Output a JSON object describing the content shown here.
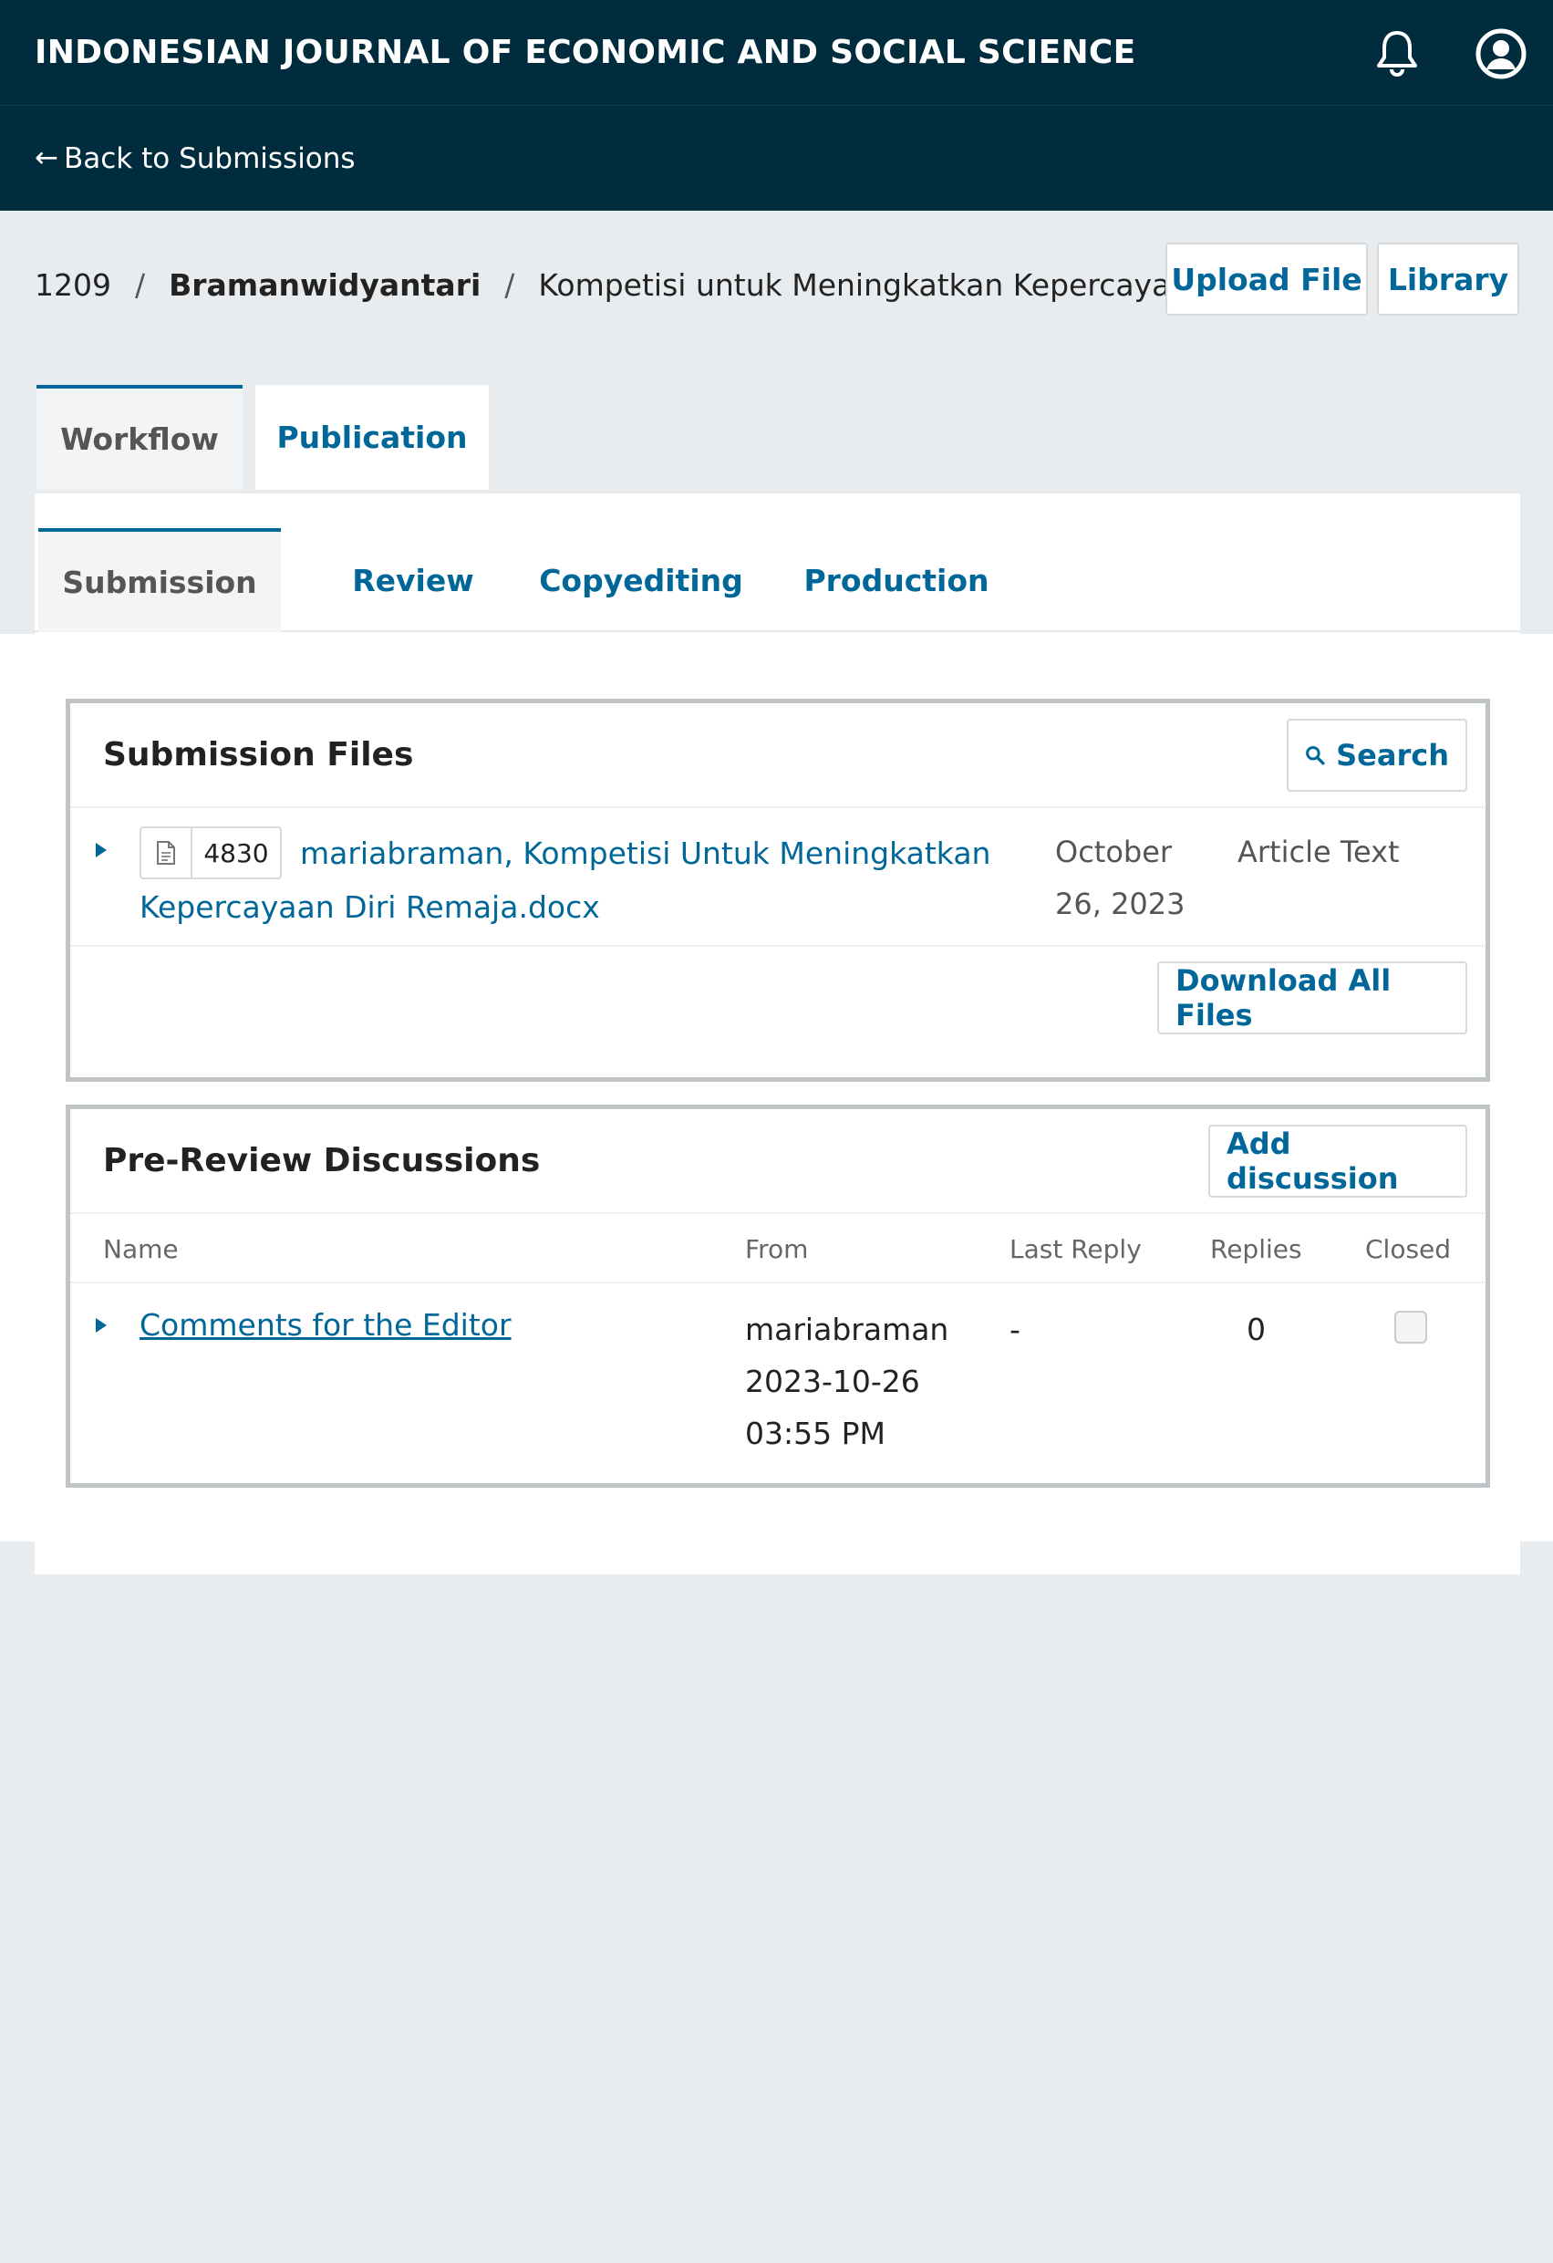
{
  "header": {
    "journal_title": "INDONESIAN JOURNAL OF ECONOMIC AND SOCIAL SCIENCE",
    "notification_icon": "bell-icon",
    "profile_icon": "user-circle-icon",
    "back_link": "Back to Submissions"
  },
  "breadcrumb": {
    "submission_id": "1209",
    "separator": "/",
    "author": "Bramanwidyantari",
    "title": "Kompetisi untuk Meningkatkan Kepercayaar"
  },
  "actions": {
    "upload_file": "Upload File",
    "library": "Library"
  },
  "tabs": {
    "workflow": "Workflow",
    "publication": "Publication"
  },
  "stages": {
    "submission": "Submission",
    "review": "Review",
    "copyediting": "Copyediting",
    "production": "Production"
  },
  "submission_files": {
    "title": "Submission Files",
    "search_label": "Search",
    "file": {
      "id": "4830",
      "name": "mariabraman, Kompetisi Untuk Meningkatkan Kepercayaan Diri Remaja.docx",
      "date": "October 26, 2023",
      "type": "Article Text"
    },
    "download_all": "Download All Files"
  },
  "discussions": {
    "title": "Pre-Review Discussions",
    "add_label": "Add discussion",
    "columns": {
      "name": "Name",
      "from": "From",
      "last_reply": "Last Reply",
      "replies": "Replies",
      "closed": "Closed"
    },
    "rows": [
      {
        "name": "Comments for the Editor",
        "from": "mariabraman 2023-10-26 03:55 PM",
        "last_reply": "-",
        "replies": "0",
        "closed": false
      }
    ]
  },
  "colors": {
    "header_bg": "#002c3e",
    "link": "#006798",
    "page_bg": "#e9ecee"
  }
}
